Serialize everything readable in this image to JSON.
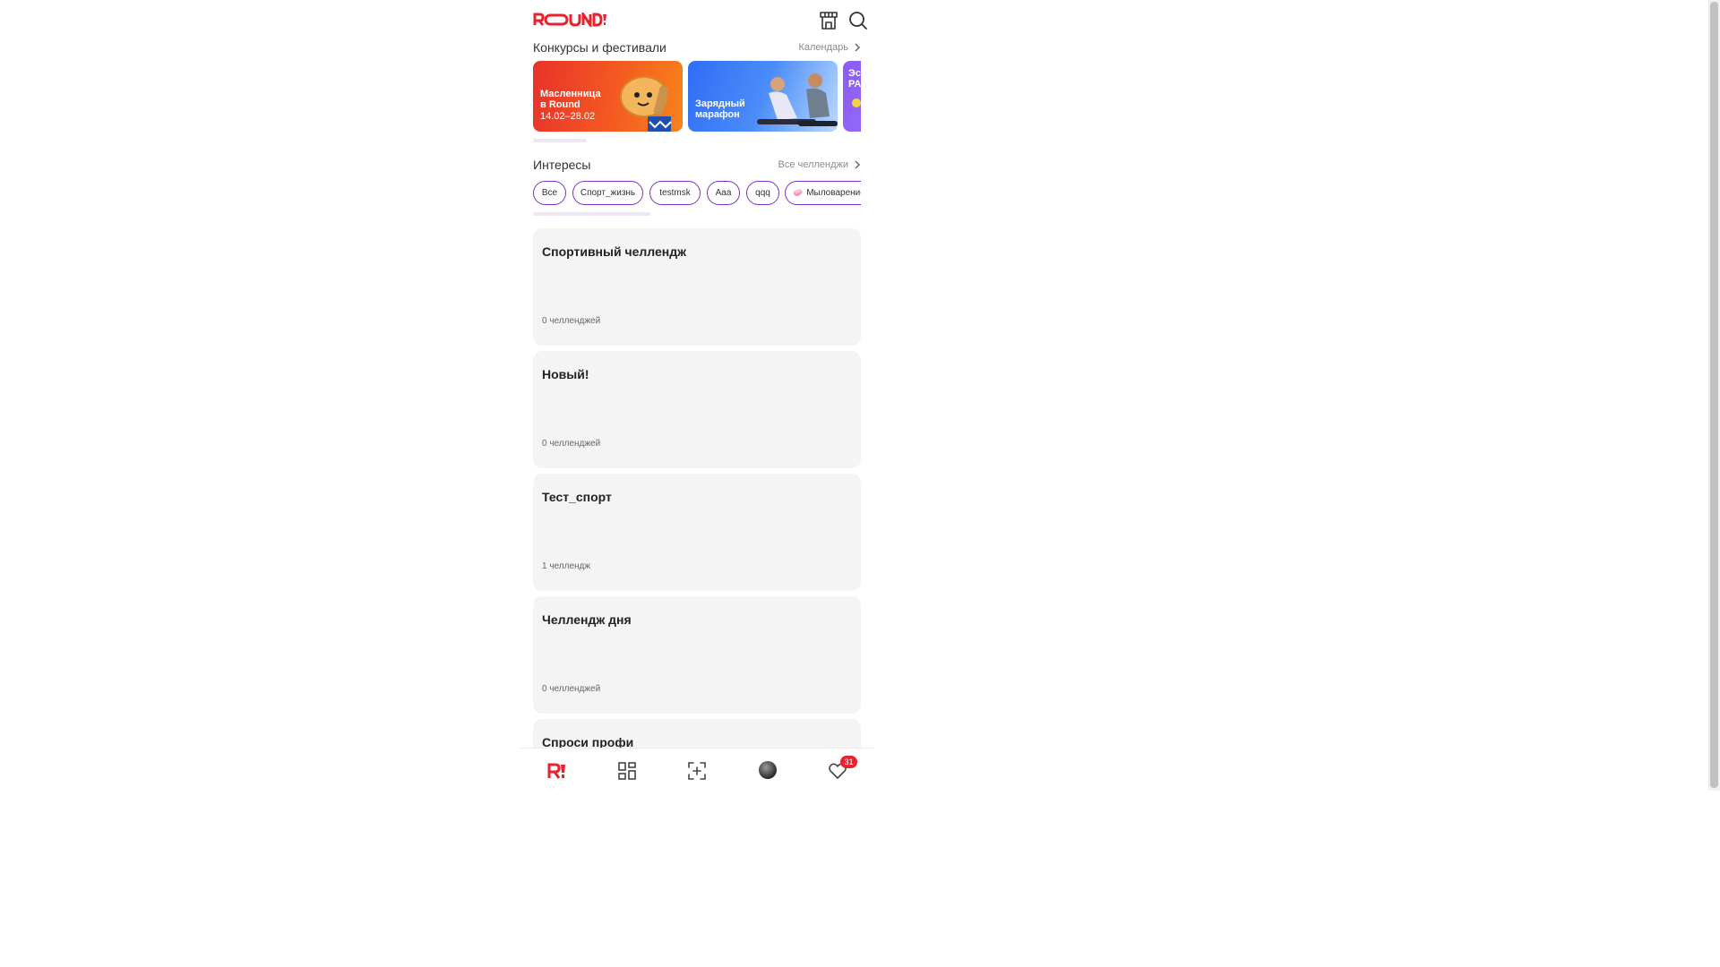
{
  "header": {
    "logo_text": "ROUND!",
    "icons": [
      "store-icon",
      "search-icon"
    ],
    "accent_color": "#e8232e"
  },
  "contests": {
    "title": "Конкурсы и фестивали",
    "link": "Календарь",
    "banners": [
      {
        "line1": "Масленница",
        "line2": "в Round",
        "date": "14.02–28.02"
      },
      {
        "line1": "Зарядный",
        "line2": "марафон",
        "date": ""
      },
      {
        "line1": "Эс",
        "line2": "РА",
        "date": ""
      }
    ]
  },
  "interests": {
    "title": "Интересы",
    "link": "Все челленджи",
    "chips": [
      "Все",
      "Спорт_жизнь",
      "testmsk",
      "Aaa",
      "qqq",
      "Мыловарение"
    ]
  },
  "categories": [
    {
      "title": "Спортивный челлендж",
      "count": "0 челленджей"
    },
    {
      "title": "Новый!",
      "count": "0 челленджей"
    },
    {
      "title": "Тест_спорт",
      "count": "1 челлендж"
    },
    {
      "title": "Челлендж дня",
      "count": "0 челленджей"
    },
    {
      "title": "Спроси профи",
      "count": ""
    }
  ],
  "bottom_nav": {
    "items": [
      "home-icon",
      "catalog-icon",
      "add-icon",
      "avatar",
      "favorites-icon"
    ],
    "badge": "31"
  }
}
